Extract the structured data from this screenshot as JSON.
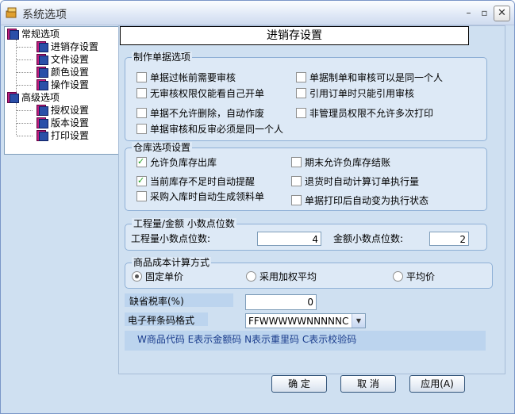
{
  "window": {
    "title": "系统选项"
  },
  "titlebar_buttons": {
    "minimize": "–",
    "maximize": "▫",
    "close": "✕"
  },
  "tree": {
    "groups": [
      {
        "label": "常规选项",
        "children": [
          "进销存设置",
          "文件设置",
          "颜色设置",
          "操作设置"
        ]
      },
      {
        "label": "高级选项",
        "children": [
          "授权设置",
          "版本设置",
          "打印设置"
        ]
      }
    ]
  },
  "panel_title": "进销存设置",
  "group_docs": {
    "title": "制作单据选项",
    "options": [
      {
        "label": "单据过帐前需要审核",
        "checked": false
      },
      {
        "label": "单据制单和审核可以是同一个人",
        "checked": false
      },
      {
        "label": "无审核权限仅能看自己开单",
        "checked": false
      },
      {
        "label": "引用订单时只能引用审核",
        "checked": false
      },
      {
        "label": "单据不允许删除，自动作废",
        "checked": false
      },
      {
        "label": "非管理员权限不允许多次打印",
        "checked": false
      },
      {
        "label": "单据审核和反审必须是同一个人",
        "checked": false
      }
    ]
  },
  "group_stock": {
    "title": "仓库选项设置",
    "options": [
      {
        "label": "允许负库存出库",
        "checked": true
      },
      {
        "label": "期末允许负库存结账",
        "checked": false
      },
      {
        "label": "当前库存不足时自动提醒",
        "checked": true
      },
      {
        "label": "退货时自动计算订单执行量",
        "checked": false
      },
      {
        "label": "采购入库时自动生成领料单",
        "checked": false
      },
      {
        "label": "单据打印后自动变为执行状态",
        "checked": false
      }
    ]
  },
  "group_decimals": {
    "title": "工程量/金额  小数点位数",
    "qty_label": "工程量小数点位数:",
    "qty_value": "4",
    "amount_label": "金额小数点位数:",
    "amount_value": "2"
  },
  "group_cost": {
    "title": "商品成本计算方式",
    "options": [
      {
        "label": "固定单价",
        "selected": true
      },
      {
        "label": "采用加权平均",
        "selected": false
      },
      {
        "label": "平均价",
        "selected": false
      }
    ]
  },
  "tax": {
    "label": "缺省税率(%)",
    "value": "0"
  },
  "barcode": {
    "label": "电子秤条码格式",
    "value": "FFWWWWWNNNNNC",
    "hint": "W商品代码 E表示金额码 N表示重里码 C表示校验码"
  },
  "buttons": {
    "ok": "确 定",
    "cancel": "取 消",
    "apply": "应用(A)"
  },
  "colors": {
    "accent": "#7a96c8",
    "panel": "#cfe0f1",
    "group": "#dde9f6"
  }
}
